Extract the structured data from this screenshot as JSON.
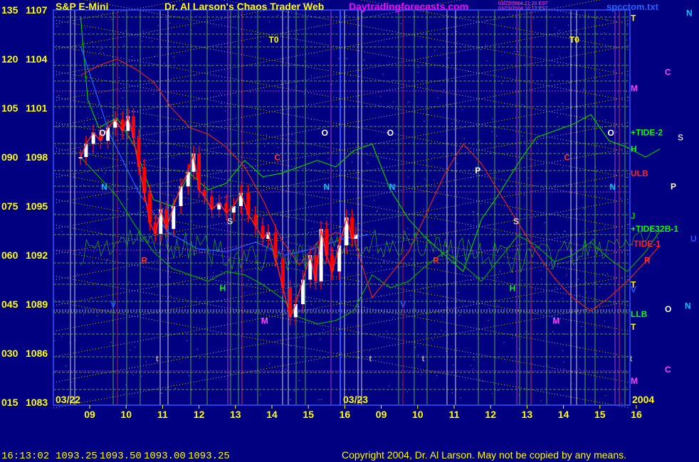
{
  "header": {
    "instrument_name": "S&P E-Mini",
    "site_title": "Dr. Al Larson's Chaos Trader Web",
    "site_url": "Daytradingforecasts.com",
    "file_name": "spcctom.txt",
    "stamp_line1": "03/22/2004 21:20 EST",
    "stamp_line2": "03/23/2004 16:13 EST"
  },
  "footer": {
    "time": "16:13:02",
    "open": "1093.25",
    "high": "1093.50",
    "low": "1093.00",
    "close": "1093.25",
    "copyright": "Copyright 2004, Dr. Al Larson. May not be copied by any means."
  },
  "colors": {
    "background": "#000080",
    "title": "#FFFF00",
    "url": "#FF00FF",
    "footer_text": "#FFFF00",
    "price_red": "#FF0000",
    "price_white": "#FFFFFF",
    "tide_green": "#00CC00",
    "red_line": "#DD2222",
    "grid_yellow": "#E8E800",
    "grid_green": "#66CC44",
    "grid_magenta": "#DD44DD",
    "blue_line": "#2266FF"
  },
  "chart_data": {
    "type": "line",
    "title": "S&P E-Mini",
    "date_labels": [
      "03/22",
      "03/23",
      "2004"
    ],
    "x_ticks": [
      "09",
      "10",
      "11",
      "12",
      "13",
      "14",
      "15",
      "16",
      "09",
      "10",
      "11",
      "12",
      "13",
      "14",
      "15",
      "16"
    ],
    "ylim": [
      1083,
      1107
    ],
    "y_ticks": [
      {
        "left": "135",
        "right": "1107",
        "price": 1107
      },
      {
        "left": "120",
        "right": "1104",
        "price": 1104
      },
      {
        "left": "105",
        "right": "1101",
        "price": 1101
      },
      {
        "left": "090",
        "right": "1098",
        "price": 1098
      },
      {
        "left": "075",
        "right": "1095",
        "price": 1095
      },
      {
        "left": "060",
        "right": "1092",
        "price": 1092
      },
      {
        "left": "045",
        "right": "1089",
        "price": 1089
      },
      {
        "left": "030",
        "right": "1086",
        "price": 1086
      },
      {
        "left": "015",
        "right": "1083",
        "price": 1083
      }
    ],
    "price_series": {
      "name": "S&P E-Mini",
      "points": [
        {
          "t": 0.0,
          "p": 1098.0
        },
        {
          "t": 0.15,
          "p": 1098.8
        },
        {
          "t": 0.35,
          "p": 1099.5
        },
        {
          "t": 0.55,
          "p": 1099.0
        },
        {
          "t": 0.75,
          "p": 1099.8
        },
        {
          "t": 0.95,
          "p": 1100.3
        },
        {
          "t": 1.15,
          "p": 1099.6
        },
        {
          "t": 1.3,
          "p": 1100.5
        },
        {
          "t": 1.45,
          "p": 1099.2
        },
        {
          "t": 1.6,
          "p": 1097.4
        },
        {
          "t": 1.75,
          "p": 1095.8
        },
        {
          "t": 1.9,
          "p": 1094.0
        },
        {
          "t": 2.05,
          "p": 1093.3
        },
        {
          "t": 2.2,
          "p": 1094.8
        },
        {
          "t": 2.35,
          "p": 1093.6
        },
        {
          "t": 2.55,
          "p": 1095.0
        },
        {
          "t": 2.75,
          "p": 1096.2
        },
        {
          "t": 2.95,
          "p": 1097.1
        },
        {
          "t": 3.1,
          "p": 1098.2
        },
        {
          "t": 3.25,
          "p": 1096.0
        },
        {
          "t": 3.4,
          "p": 1095.6
        },
        {
          "t": 3.6,
          "p": 1094.8
        },
        {
          "t": 3.8,
          "p": 1095.2
        },
        {
          "t": 4.0,
          "p": 1094.6
        },
        {
          "t": 4.2,
          "p": 1095.0
        },
        {
          "t": 4.4,
          "p": 1095.8
        },
        {
          "t": 4.6,
          "p": 1094.5
        },
        {
          "t": 4.8,
          "p": 1093.8
        },
        {
          "t": 5.0,
          "p": 1093.0
        },
        {
          "t": 5.15,
          "p": 1093.4
        },
        {
          "t": 5.35,
          "p": 1091.8
        },
        {
          "t": 5.55,
          "p": 1090.0
        },
        {
          "t": 5.75,
          "p": 1088.2
        },
        {
          "t": 5.9,
          "p": 1089.0
        },
        {
          "t": 6.1,
          "p": 1090.5
        },
        {
          "t": 6.3,
          "p": 1092.0
        },
        {
          "t": 6.45,
          "p": 1090.4
        },
        {
          "t": 6.6,
          "p": 1093.6
        },
        {
          "t": 6.75,
          "p": 1092.0
        },
        {
          "t": 6.9,
          "p": 1091.0
        },
        {
          "t": 7.1,
          "p": 1092.6
        },
        {
          "t": 7.3,
          "p": 1094.3
        },
        {
          "t": 7.45,
          "p": 1093.0
        },
        {
          "t": 7.55,
          "p": 1093.25
        }
      ]
    },
    "tide_lines": [
      {
        "label": "+TIDE-2",
        "color": "#00CC00",
        "points": [
          {
            "t": 0.0,
            "p": 1106.6
          },
          {
            "t": 0.2,
            "p": 1101.5
          },
          {
            "t": 0.5,
            "p": 1099.8
          },
          {
            "t": 1.0,
            "p": 1100.4
          },
          {
            "t": 1.5,
            "p": 1098.6
          },
          {
            "t": 2.0,
            "p": 1095.4
          },
          {
            "t": 2.5,
            "p": 1095.0
          },
          {
            "t": 3.0,
            "p": 1097.0
          },
          {
            "t": 3.5,
            "p": 1096.0
          },
          {
            "t": 4.0,
            "p": 1096.4
          },
          {
            "t": 4.5,
            "p": 1097.8
          },
          {
            "t": 5.0,
            "p": 1096.8
          },
          {
            "t": 5.5,
            "p": 1097.0
          },
          {
            "t": 6.0,
            "p": 1097.4
          },
          {
            "t": 6.5,
            "p": 1097.8
          },
          {
            "t": 7.0,
            "p": 1097.4
          },
          {
            "t": 7.5,
            "p": 1098.4
          },
          {
            "t": 8.0,
            "p": 1098.8
          },
          {
            "t": 8.5,
            "p": 1096.0
          },
          {
            "t": 9.0,
            "p": 1094.2
          },
          {
            "t": 9.5,
            "p": 1093.0
          },
          {
            "t": 10.0,
            "p": 1092.0
          },
          {
            "t": 10.5,
            "p": 1091.0
          },
          {
            "t": 11.0,
            "p": 1094.2
          },
          {
            "t": 11.5,
            "p": 1095.8
          },
          {
            "t": 12.0,
            "p": 1097.6
          },
          {
            "t": 12.5,
            "p": 1099.2
          },
          {
            "t": 13.0,
            "p": 1099.6
          },
          {
            "t": 13.5,
            "p": 1100.0
          },
          {
            "t": 14.0,
            "p": 1100.6
          },
          {
            "t": 14.5,
            "p": 1099.0
          },
          {
            "t": 15.0,
            "p": 1098.6
          },
          {
            "t": 15.5,
            "p": 1098.0
          },
          {
            "t": 15.9,
            "p": 1098.5
          }
        ]
      },
      {
        "label": "+TIDE32B-1",
        "color": "#00AA00",
        "points": [
          {
            "t": 0.0,
            "p": 1098.0
          },
          {
            "t": 0.5,
            "p": 1096.8
          },
          {
            "t": 1.0,
            "p": 1095.6
          },
          {
            "t": 1.5,
            "p": 1093.8
          },
          {
            "t": 2.0,
            "p": 1092.2
          },
          {
            "t": 2.5,
            "p": 1091.2
          },
          {
            "t": 3.0,
            "p": 1090.8
          },
          {
            "t": 3.5,
            "p": 1090.4
          },
          {
            "t": 4.0,
            "p": 1091.0
          },
          {
            "t": 4.5,
            "p": 1090.8
          },
          {
            "t": 5.0,
            "p": 1090.2
          },
          {
            "t": 5.5,
            "p": 1089.4
          },
          {
            "t": 6.0,
            "p": 1088.2
          },
          {
            "t": 6.5,
            "p": 1087.8
          },
          {
            "t": 7.0,
            "p": 1088.0
          },
          {
            "t": 7.5,
            "p": 1088.6
          },
          {
            "t": 8.0,
            "p": 1090.8
          },
          {
            "t": 8.5,
            "p": 1090.0
          },
          {
            "t": 9.0,
            "p": 1090.4
          },
          {
            "t": 9.5,
            "p": 1091.4
          },
          {
            "t": 10.0,
            "p": 1092.2
          },
          {
            "t": 10.5,
            "p": 1091.4
          },
          {
            "t": 11.0,
            "p": 1090.4
          },
          {
            "t": 11.5,
            "p": 1091.8
          },
          {
            "t": 12.0,
            "p": 1093.2
          },
          {
            "t": 12.5,
            "p": 1092.6
          },
          {
            "t": 13.0,
            "p": 1091.6
          },
          {
            "t": 13.5,
            "p": 1092.0
          },
          {
            "t": 14.0,
            "p": 1092.8
          },
          {
            "t": 14.5,
            "p": 1091.8
          },
          {
            "t": 15.0,
            "p": 1091.0
          },
          {
            "t": 15.5,
            "p": 1092.2
          },
          {
            "t": 15.9,
            "p": 1093.5
          }
        ]
      },
      {
        "label": "-TIDE-1",
        "color": "#DD2222",
        "points": [
          {
            "t": 0.0,
            "p": 1103.0
          },
          {
            "t": 0.5,
            "p": 1103.6
          },
          {
            "t": 1.0,
            "p": 1104.0
          },
          {
            "t": 1.5,
            "p": 1103.4
          },
          {
            "t": 2.0,
            "p": 1102.6
          },
          {
            "t": 2.5,
            "p": 1101.0
          },
          {
            "t": 3.0,
            "p": 1099.8
          },
          {
            "t": 3.5,
            "p": 1099.4
          },
          {
            "t": 4.0,
            "p": 1098.6
          },
          {
            "t": 4.5,
            "p": 1097.4
          },
          {
            "t": 5.0,
            "p": 1095.4
          },
          {
            "t": 5.5,
            "p": 1093.0
          },
          {
            "t": 6.0,
            "p": 1091.4
          },
          {
            "t": 6.5,
            "p": 1092.8
          },
          {
            "t": 7.0,
            "p": 1093.4
          },
          {
            "t": 7.5,
            "p": 1093.0
          },
          {
            "t": 8.0,
            "p": 1089.4
          },
          {
            "t": 8.5,
            "p": 1090.8
          },
          {
            "t": 9.0,
            "p": 1092.2
          },
          {
            "t": 9.5,
            "p": 1094.6
          },
          {
            "t": 10.0,
            "p": 1097.0
          },
          {
            "t": 10.5,
            "p": 1098.8
          },
          {
            "t": 11.0,
            "p": 1097.6
          },
          {
            "t": 11.5,
            "p": 1095.8
          },
          {
            "t": 12.0,
            "p": 1094.0
          },
          {
            "t": 12.5,
            "p": 1092.2
          },
          {
            "t": 13.0,
            "p": 1090.6
          },
          {
            "t": 13.5,
            "p": 1089.4
          },
          {
            "t": 14.0,
            "p": 1088.6
          },
          {
            "t": 14.5,
            "p": 1089.4
          },
          {
            "t": 15.0,
            "p": 1090.4
          },
          {
            "t": 15.5,
            "p": 1091.6
          },
          {
            "t": 15.9,
            "p": 1092.6
          }
        ]
      }
    ],
    "blue_line": {
      "points": [
        {
          "t": 0.0,
          "p": 1104.8
        },
        {
          "t": 0.8,
          "p": 1099.4
        },
        {
          "t": 1.6,
          "p": 1095.8
        },
        {
          "t": 2.4,
          "p": 1093.4
        },
        {
          "t": 3.2,
          "p": 1092.4
        },
        {
          "t": 4.0,
          "p": 1092.2
        },
        {
          "t": 4.8,
          "p": 1092.8
        },
        {
          "t": 5.6,
          "p": 1092.0
        },
        {
          "t": 6.4,
          "p": 1092.4
        },
        {
          "t": 7.2,
          "p": 1093.0
        },
        {
          "t": 7.9,
          "p": 1093.25
        }
      ]
    },
    "right_labels": [
      {
        "text": "T",
        "p": 1106.5,
        "color": "#FFFF00"
      },
      {
        "text": "M",
        "p": 1102.2,
        "color": "#FF44FF"
      },
      {
        "text": "+TIDE-2",
        "p": 1099.5,
        "color": "#00FF00"
      },
      {
        "text": "H",
        "p": 1098.5,
        "color": "#00FF00"
      },
      {
        "text": "ULB",
        "p": 1097.0,
        "color": "#FF2222"
      },
      {
        "text": "J",
        "p": 1094.4,
        "color": "#00CC00"
      },
      {
        "text": "+TIDE32B-1",
        "p": 1093.6,
        "color": "#00FF00"
      },
      {
        "text": "-TIDE-1",
        "p": 1092.7,
        "color": "#FF2222"
      },
      {
        "text": "T",
        "p": 1090.2,
        "color": "#FFFF00"
      },
      {
        "text": "V",
        "p": 1089.9,
        "color": "#2255FF"
      },
      {
        "text": "LLB",
        "p": 1088.4,
        "color": "#00FF00"
      },
      {
        "text": "T",
        "p": 1087.6,
        "color": "#FFFF00"
      },
      {
        "text": "M",
        "p": 1084.3,
        "color": "#FF44FF"
      }
    ],
    "far_right_labels": [
      {
        "text": "N",
        "p": 1106.8,
        "color": "#00CCFF"
      },
      {
        "text": "C",
        "p": 1103.2,
        "color": "#FF44FF"
      },
      {
        "text": "S",
        "p": 1099.2,
        "color": "#CCCCCC"
      },
      {
        "text": "P",
        "p": 1096.2,
        "color": "#FFFFFF"
      },
      {
        "text": "U",
        "p": 1093.0,
        "color": "#2255FF"
      },
      {
        "text": "O",
        "p": 1088.7,
        "color": "#FFFFFF"
      },
      {
        "text": "N",
        "p": 1088.9,
        "color": "#00CCFF"
      },
      {
        "text": "C",
        "p": 1085.0,
        "color": "#FF44FF"
      }
    ],
    "plot_markers": [
      {
        "text": "T0",
        "t": 5.3,
        "p": 1105.0,
        "color": "#FFFF00"
      },
      {
        "text": "T0",
        "t": 13.55,
        "p": 1105.0,
        "color": "#FFFF00"
      },
      {
        "text": "O",
        "t": 0.6,
        "p": 1099.3,
        "color": "#FFFFFF"
      },
      {
        "text": "O",
        "t": 6.7,
        "p": 1099.3,
        "color": "#FFFFFF"
      },
      {
        "text": "O",
        "t": 8.5,
        "p": 1099.3,
        "color": "#FFFFFF"
      },
      {
        "text": "O",
        "t": 14.55,
        "p": 1099.3,
        "color": "#FFFFFF"
      },
      {
        "text": "N",
        "t": 0.65,
        "p": 1096.0,
        "color": "#00CCFF"
      },
      {
        "text": "N",
        "t": 6.75,
        "p": 1096.0,
        "color": "#00CCFF"
      },
      {
        "text": "N",
        "t": 8.55,
        "p": 1096.0,
        "color": "#00CCFF"
      },
      {
        "text": "N",
        "t": 14.6,
        "p": 1096.0,
        "color": "#00CCFF"
      },
      {
        "text": "C",
        "t": 5.4,
        "p": 1097.8,
        "color": "#FF3333"
      },
      {
        "text": "C",
        "t": 13.35,
        "p": 1097.8,
        "color": "#FF3333"
      },
      {
        "text": "P",
        "t": 10.9,
        "p": 1097.0,
        "color": "#FFFFFF"
      },
      {
        "text": "S",
        "t": 4.1,
        "p": 1093.9,
        "color": "#CCCCCC"
      },
      {
        "text": "S",
        "t": 11.95,
        "p": 1093.9,
        "color": "#CCCCCC"
      },
      {
        "text": "H",
        "t": 3.9,
        "p": 1089.8,
        "color": "#00FF00"
      },
      {
        "text": "H",
        "t": 11.85,
        "p": 1089.8,
        "color": "#00FF00"
      },
      {
        "text": "R",
        "t": 1.75,
        "p": 1091.5,
        "color": "#FF3333"
      },
      {
        "text": "R",
        "t": 9.75,
        "p": 1091.5,
        "color": "#FF3333"
      },
      {
        "text": "R",
        "t": 15.55,
        "p": 1091.5,
        "color": "#FF3333"
      },
      {
        "text": "V",
        "t": 0.9,
        "p": 1088.8,
        "color": "#2255FF"
      },
      {
        "text": "V",
        "t": 8.85,
        "p": 1088.8,
        "color": "#2255FF"
      },
      {
        "text": "M",
        "t": 5.05,
        "p": 1087.8,
        "color": "#FF44FF"
      },
      {
        "text": "M",
        "t": 13.05,
        "p": 1087.8,
        "color": "#FF44FF"
      },
      {
        "text": "t",
        "t": 2.1,
        "p": 1085.5,
        "color": "#AAAAAA"
      },
      {
        "text": "t",
        "t": 7.95,
        "p": 1085.5,
        "color": "#AAAAAA"
      },
      {
        "text": "t",
        "t": 9.4,
        "p": 1085.5,
        "color": "#AAAAAA"
      },
      {
        "text": "t",
        "t": 15.1,
        "p": 1085.5,
        "color": "#AAAAAA"
      }
    ]
  }
}
